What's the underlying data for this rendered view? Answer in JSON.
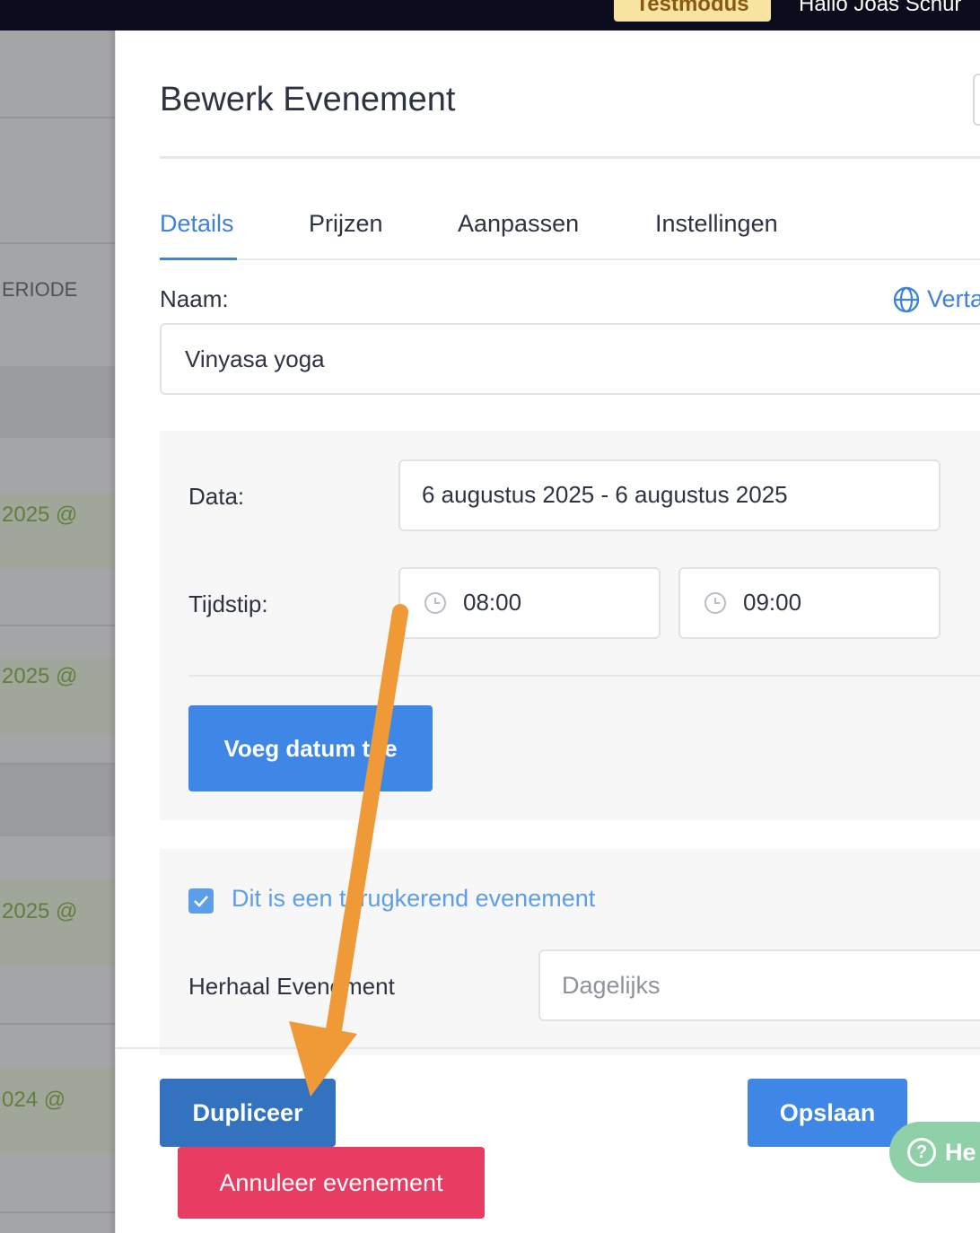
{
  "topbar": {
    "test_badge": "Testmodus",
    "greeting": "Hallo Joas Schur"
  },
  "background_list": {
    "rows": [
      {
        "text": "ERIODE"
      },
      {
        "text": "2025 @"
      },
      {
        "text": "2025 @"
      },
      {
        "text": "2025 @"
      },
      {
        "text": "024 @"
      }
    ]
  },
  "modal": {
    "title": "Bewerk Evenement",
    "tabs": [
      {
        "label": "Details"
      },
      {
        "label": "Prijzen"
      },
      {
        "label": "Aanpassen"
      },
      {
        "label": "Instellingen"
      }
    ],
    "active_tab": "Details",
    "name_label": "Naam:",
    "translate_label": "Verta",
    "name_value": "Vinyasa yoga",
    "date_label": "Data:",
    "date_value": "6 augustus 2025 - 6 augustus 2025",
    "time_label": "Tijdstip:",
    "start_time": "08:00",
    "end_time": "09:00",
    "add_date_button": "Voeg datum toe",
    "recurring_checked": true,
    "recurring_label": "Dit is een terugkerend evenement",
    "repeat_label": "Herhaal Evenement",
    "repeat_value": "Dagelijks",
    "duplicate_button": "Dupliceer",
    "save_button": "Opslaan",
    "cancel_button": "Annuleer evenement",
    "help_label": "He"
  },
  "colors": {
    "accent": "#3f87e6",
    "danger": "#e83c63",
    "annotation_arrow": "#f09a37"
  }
}
